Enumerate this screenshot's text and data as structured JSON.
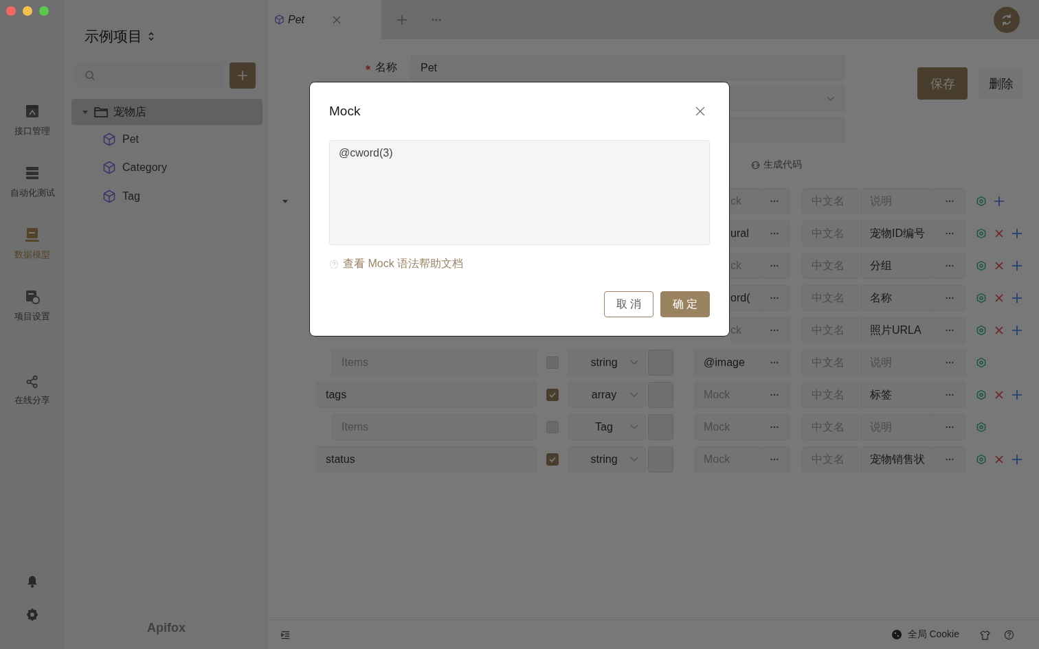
{
  "rail": {
    "items": [
      {
        "label": "接口管理",
        "selected": false
      },
      {
        "label": "自动化测试",
        "selected": false
      },
      {
        "label": "数据模型",
        "selected": true
      },
      {
        "label": "项目设置",
        "selected": false
      }
    ],
    "share": "在线分享"
  },
  "project": {
    "title": "示例项目"
  },
  "tree": [
    {
      "label": "宠物店",
      "expanded": true,
      "selected": true,
      "children": [
        {
          "label": "Pet"
        },
        {
          "label": "Category"
        },
        {
          "label": "Tag"
        }
      ]
    }
  ],
  "logo": "Apifox",
  "tabs": [
    {
      "label": "Pet",
      "selected": true
    }
  ],
  "form": {
    "fields": [
      {
        "kind": "input",
        "label": "名称",
        "required": true,
        "value": "Pet"
      },
      {
        "kind": "select"
      },
      {
        "kind": "input"
      }
    ]
  },
  "actions": [
    {
      "label": "保存",
      "kind": "primary"
    },
    {
      "label": "删除",
      "kind": "default"
    }
  ],
  "generate_code": "生成代码",
  "rows": [
    {
      "expanded": true,
      "mock": {
        "placeholder": "ck"
      },
      "title": {
        "placeholder": "中文名"
      },
      "description": {
        "placeholder": "说明"
      },
      "deletable": false,
      "addable": true
    },
    {
      "mock": {
        "value": "ural"
      },
      "title": {
        "placeholder": "中文名"
      },
      "description": {
        "value": "宠物ID编号"
      },
      "deletable": true,
      "addable": true
    },
    {
      "mock": {
        "placeholder": "ck"
      },
      "title": {
        "placeholder": "中文名"
      },
      "description": {
        "value": "分组"
      },
      "deletable": true,
      "addable": true
    },
    {
      "mock": {
        "value": "ord("
      },
      "title": {
        "placeholder": "中文名"
      },
      "description": {
        "value": "名称"
      },
      "deletable": true,
      "addable": true
    },
    {
      "mock": {
        "placeholder": "ck"
      },
      "title": {
        "placeholder": "中文名"
      },
      "description": {
        "value": "照片URLA"
      },
      "deletable": true,
      "addable": true
    },
    {
      "child": true,
      "name": {
        "placeholder": "Items"
      },
      "checked": false,
      "disabled": true,
      "type": "string",
      "mock": {
        "value": "@image"
      },
      "title": {
        "placeholder": "中文名"
      },
      "description": {
        "placeholder": "说明"
      },
      "deletable": false,
      "addable": false
    },
    {
      "child": false,
      "name": {
        "value": "tags"
      },
      "checked": true,
      "disabled": false,
      "type": "array",
      "mock": {
        "placeholder": "Mock"
      },
      "title": {
        "placeholder": "中文名"
      },
      "description": {
        "value": "标签"
      },
      "deletable": true,
      "addable": true
    },
    {
      "child": true,
      "name": {
        "placeholder": "Items"
      },
      "checked": false,
      "disabled": true,
      "type": "Tag",
      "mock": {
        "placeholder": "Mock"
      },
      "title": {
        "placeholder": "中文名"
      },
      "description": {
        "placeholder": "说明"
      },
      "deletable": false,
      "addable": false
    },
    {
      "child": false,
      "name": {
        "value": "status"
      },
      "checked": true,
      "disabled": false,
      "type": "string",
      "mock": {
        "placeholder": "Mock"
      },
      "title": {
        "placeholder": "中文名"
      },
      "description": {
        "value": "宠物销售状"
      },
      "deletable": true,
      "addable": true
    }
  ],
  "status_bar": {
    "cookie": "全局 Cookie"
  },
  "dialog": {
    "title": "Mock",
    "value": "@cword(3)",
    "help_link": "查看 Mock 语法帮助文档",
    "buttons": [
      {
        "label": "取 消",
        "kind": "default"
      },
      {
        "label": "确 定",
        "kind": "primary"
      }
    ]
  }
}
